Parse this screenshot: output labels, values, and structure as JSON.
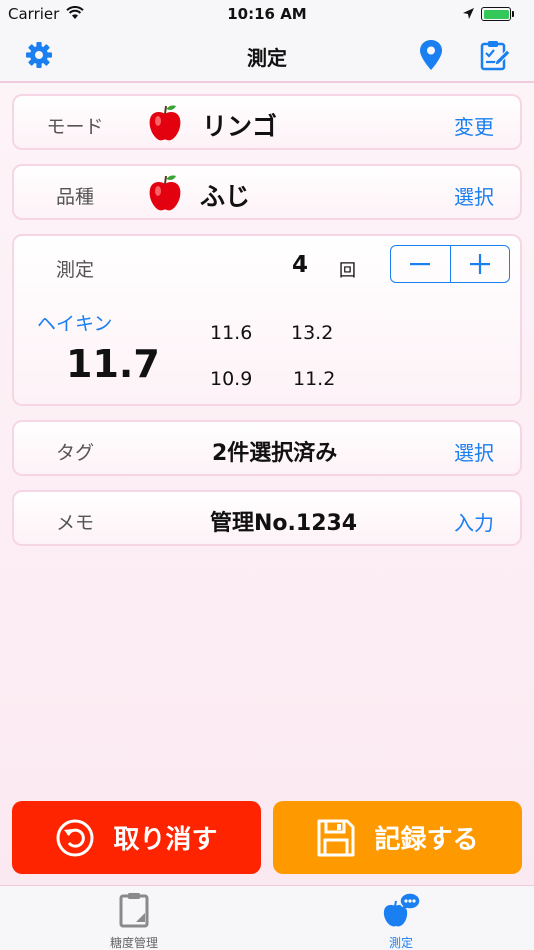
{
  "status_bar": {
    "carrier": "Carrier",
    "time": "10:16 AM"
  },
  "nav": {
    "title": "測定",
    "left_icon": "gear-icon",
    "right_icons": [
      "location-pin-icon",
      "edit-form-icon"
    ]
  },
  "mode": {
    "label": "モード",
    "value": "リンゴ",
    "action": "変更"
  },
  "variety": {
    "label": "品種",
    "value": "ふじ",
    "action": "選択"
  },
  "measurement": {
    "label": "測定",
    "count": "4",
    "count_unit": "回",
    "average_label": "ヘイキン",
    "average_value": "11.7",
    "readings": [
      "11.6",
      "13.2",
      "10.9",
      "11.2"
    ]
  },
  "tags": {
    "label": "タグ",
    "value": "2件選択済み",
    "action": "選択"
  },
  "memo": {
    "label": "メモ",
    "value": "管理No.1234",
    "action": "入力"
  },
  "buttons": {
    "cancel": "取り消す",
    "save": "記録する"
  },
  "tab_bar": {
    "items": [
      {
        "label": "糖度管理",
        "icon": "clipboard-icon"
      },
      {
        "label": "測定",
        "icon": "apple-chat-icon",
        "active": true
      }
    ]
  },
  "colors": {
    "accent": "#1a7ff0",
    "cancel": "#ff2400",
    "save": "#ff9900",
    "card_border": "#f6d6e4"
  }
}
